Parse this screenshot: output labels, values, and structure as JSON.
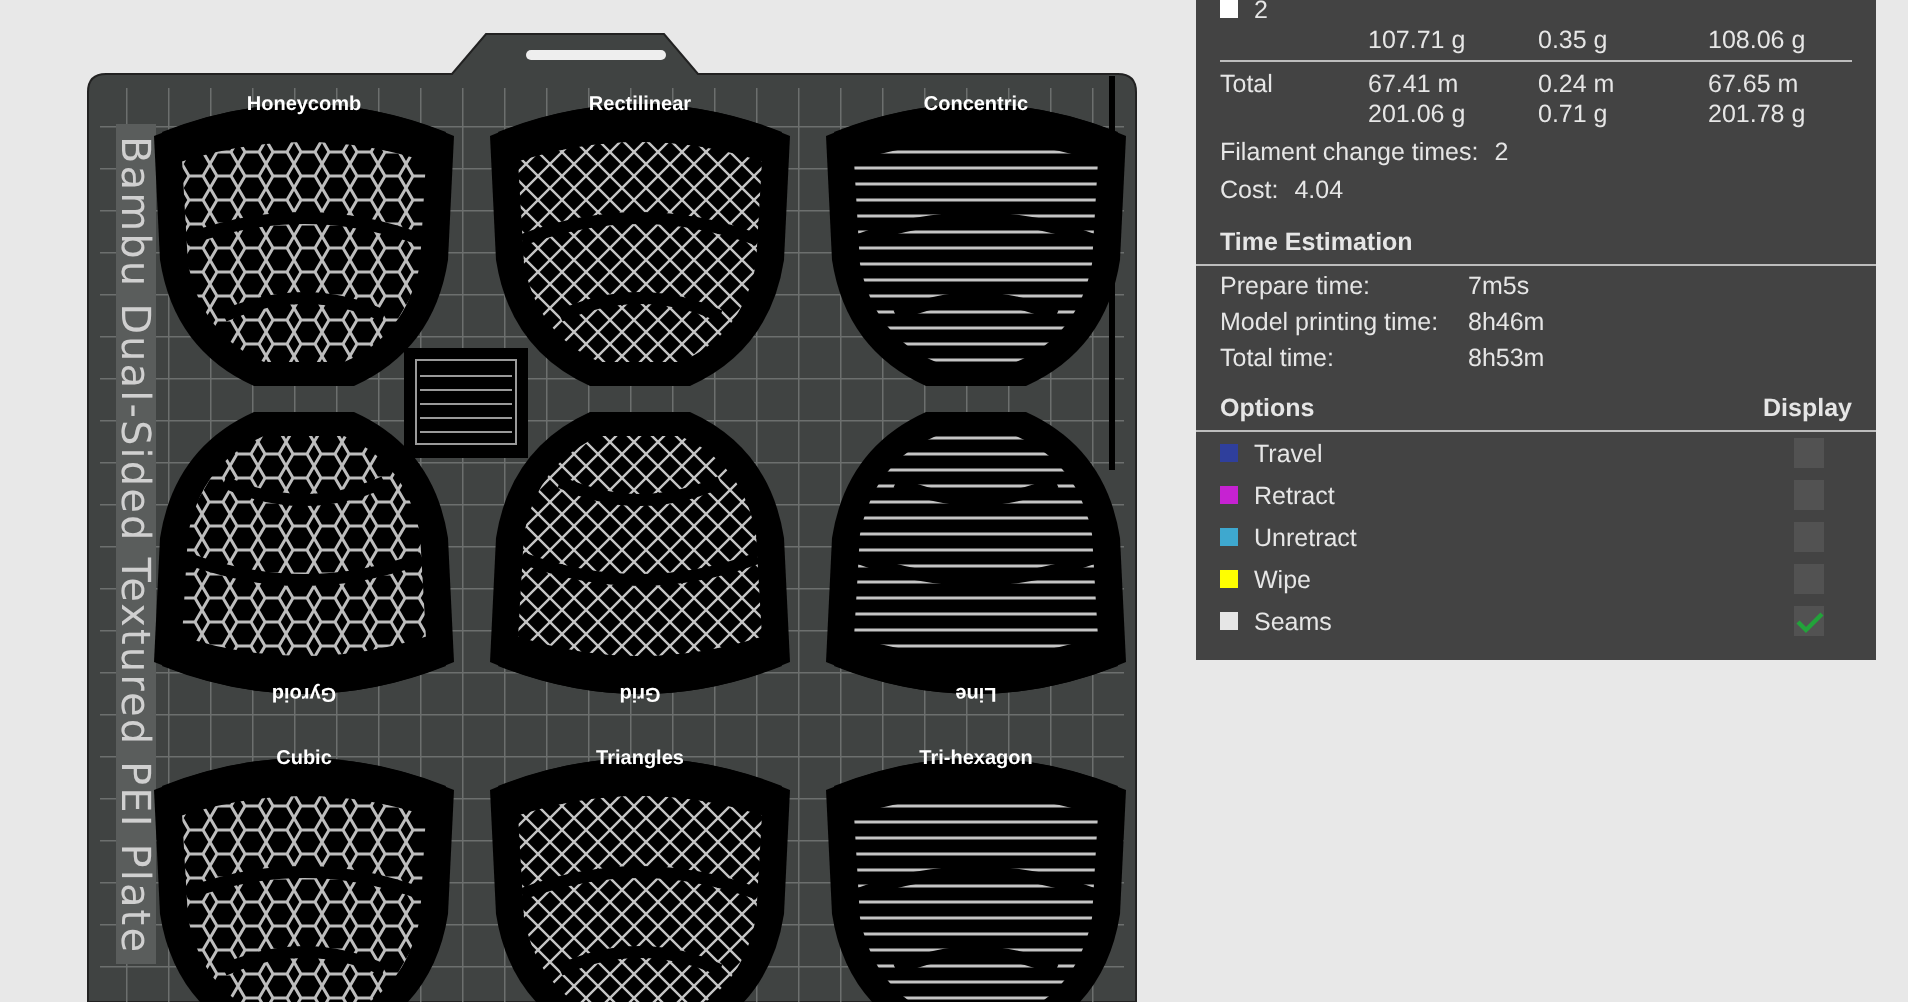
{
  "plate": {
    "label": "Bambu Dual-Sided Textured PEI Plate",
    "models": [
      {
        "label": "Honeycomb",
        "flipped": false
      },
      {
        "label": "Rectilinear",
        "flipped": false
      },
      {
        "label": "Concentric",
        "flipped": false
      },
      {
        "label": "Gyroid",
        "flipped": true
      },
      {
        "label": "Grid",
        "flipped": true
      },
      {
        "label": "Line",
        "flipped": true
      },
      {
        "label": "Cubic",
        "flipped": false
      },
      {
        "label": "Triangles",
        "flipped": false
      },
      {
        "label": "Tri-hexagon",
        "flipped": false
      }
    ]
  },
  "usage": {
    "rows": [
      {
        "name": "2",
        "color": "#ffffff",
        "cells": [
          "107.71 g",
          "0.35 g",
          "108.06 g"
        ]
      }
    ],
    "total": {
      "label": "Total",
      "cells": [
        [
          "67.41 m",
          "201.06 g"
        ],
        [
          "0.24 m",
          "0.71 g"
        ],
        [
          "67.65 m",
          "201.78 g"
        ]
      ]
    },
    "filament_change": {
      "label": "Filament change times:",
      "value": "2"
    },
    "cost": {
      "label": "Cost:",
      "value": "4.04"
    }
  },
  "time_estimation": {
    "title": "Time Estimation",
    "rows": [
      {
        "label": "Prepare time:",
        "value": "7m5s"
      },
      {
        "label": "Model printing time:",
        "value": "8h46m"
      },
      {
        "label": "Total time:",
        "value": "8h53m"
      }
    ]
  },
  "options": {
    "title": "Options",
    "display_title": "Display",
    "items": [
      {
        "label": "Travel",
        "color": "#2f3f9c",
        "checked": false
      },
      {
        "label": "Retract",
        "color": "#c622d2",
        "checked": false
      },
      {
        "label": "Unretract",
        "color": "#3ea8cf",
        "checked": false
      },
      {
        "label": "Wipe",
        "color": "#ffff00",
        "checked": false
      },
      {
        "label": "Seams",
        "color": "#e6e6e6",
        "checked": true
      }
    ]
  }
}
